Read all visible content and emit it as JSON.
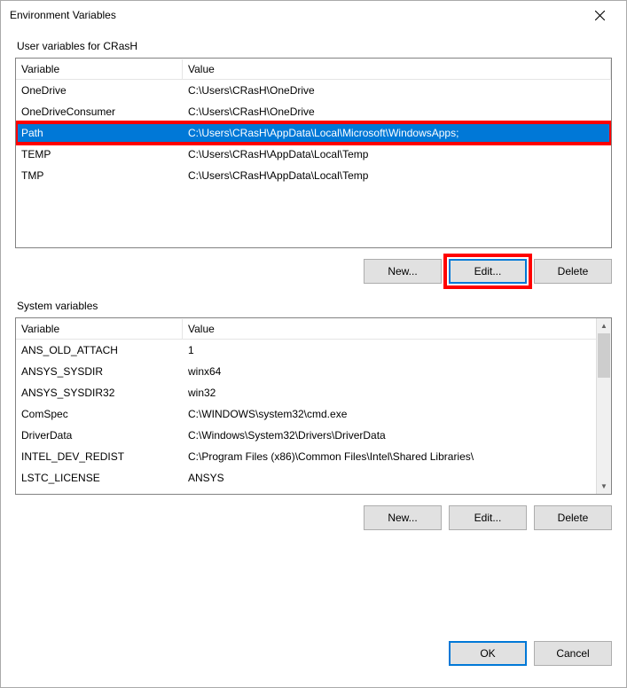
{
  "window": {
    "title": "Environment Variables"
  },
  "user": {
    "group_label": "User variables for CRasH",
    "columns": {
      "variable": "Variable",
      "value": "Value"
    },
    "rows": [
      {
        "name": "OneDrive",
        "value": "C:\\Users\\CRasH\\OneDrive"
      },
      {
        "name": "OneDriveConsumer",
        "value": "C:\\Users\\CRasH\\OneDrive"
      },
      {
        "name": "Path",
        "value": "C:\\Users\\CRasH\\AppData\\Local\\Microsoft\\WindowsApps;"
      },
      {
        "name": "TEMP",
        "value": "C:\\Users\\CRasH\\AppData\\Local\\Temp"
      },
      {
        "name": "TMP",
        "value": "C:\\Users\\CRasH\\AppData\\Local\\Temp"
      }
    ],
    "buttons": {
      "new": "New...",
      "edit": "Edit...",
      "delete": "Delete"
    }
  },
  "system": {
    "group_label": "System variables",
    "columns": {
      "variable": "Variable",
      "value": "Value"
    },
    "rows": [
      {
        "name": "ANS_OLD_ATTACH",
        "value": "1"
      },
      {
        "name": "ANSYS_SYSDIR",
        "value": "winx64"
      },
      {
        "name": "ANSYS_SYSDIR32",
        "value": "win32"
      },
      {
        "name": "ComSpec",
        "value": "C:\\WINDOWS\\system32\\cmd.exe"
      },
      {
        "name": "DriverData",
        "value": "C:\\Windows\\System32\\Drivers\\DriverData"
      },
      {
        "name": "INTEL_DEV_REDIST",
        "value": "C:\\Program Files (x86)\\Common Files\\Intel\\Shared Libraries\\"
      },
      {
        "name": "LSTC_LICENSE",
        "value": "ANSYS"
      }
    ],
    "buttons": {
      "new": "New...",
      "edit": "Edit...",
      "delete": "Delete"
    }
  },
  "footer": {
    "ok": "OK",
    "cancel": "Cancel"
  }
}
